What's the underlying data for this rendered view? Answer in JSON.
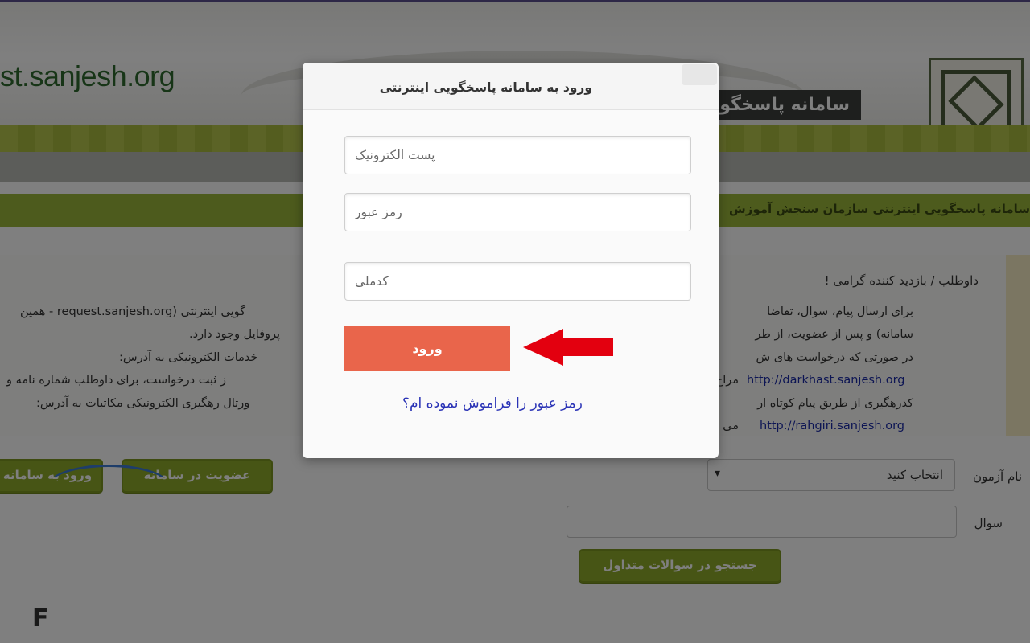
{
  "site": {
    "url": "st.sanjesh.org",
    "title": "سامانه پاسخگو",
    "marquee": "سامانه پاسخگویی اینترنتی سازمان سنجش آموزش"
  },
  "notice": {
    "greeting": "داوطلب / بازدید کننده گرامی !",
    "line1": "برای ارسال پیام، سوال، تقاضا",
    "line1b": "گویی اینترنتی (request.sanjesh.org - همین",
    "line2": "سامانه) و پس از عضویت، از طر",
    "line2b": "پروفایل وجود دارد.",
    "line3": "در صورتی که درخواست های ش",
    "line3b": "خدمات الکترونیکی به آدرس:",
    "line4": "مراج",
    "line4b": "ز ثبت درخواست، برای داوطلب شماره نامه و",
    "link1": "http://darkhast.sanjesh.org",
    "line5": "کدرهگیری از طریق پیام کوتاه ار",
    "line5b": "ورتال رهگیری الکترونیکی مکاتبات به آدرس:",
    "link2": "http://rahgiri.sanjesh.org",
    "line6": "می با"
  },
  "buttons": {
    "login_system": "ورود به سامانه",
    "register": "عضویت در سامانه",
    "faq_search": "جستجو در سوالات متداول"
  },
  "search_form": {
    "exam_label": "نام آزمون",
    "exam_selected": "انتخاب کنید",
    "question_label": "سوال"
  },
  "modal": {
    "title": "ورود به سامانه پاسخگویی اینترنتی",
    "email_placeholder": "پست الکترونیک",
    "password_placeholder": "رمز عبور",
    "national_code_placeholder": "کدملی",
    "login_button": "ورود",
    "forgot_password": "رمز عبور را فراموش نموده ام؟"
  },
  "colors": {
    "login_button": "#e9654b",
    "arrow": "#e3000f",
    "link": "#2a33b6",
    "brand_green": "#8faa2a"
  },
  "icons": {
    "close": "close-icon",
    "arrow": "left-arrow-icon",
    "dropdown": "chevron-down-icon"
  }
}
